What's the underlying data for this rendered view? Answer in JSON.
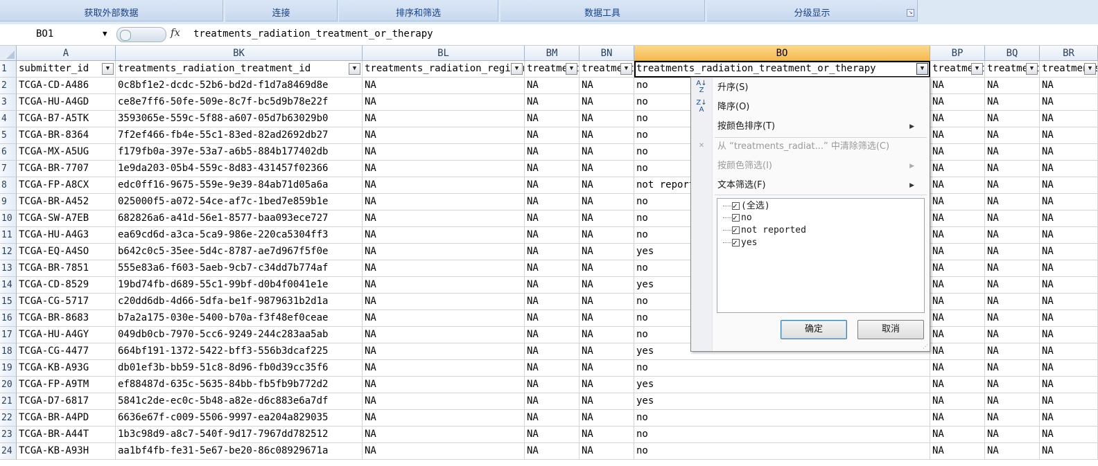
{
  "ribbon": {
    "groups": [
      "获取外部数据",
      "连接",
      "排序和筛选",
      "数据工具",
      "分级显示"
    ]
  },
  "formula_bar": {
    "name_box": "BO1",
    "fx": "fx",
    "formula": "treatments_radiation_treatment_or_therapy"
  },
  "columns": [
    "A",
    "BK",
    "BL",
    "BM",
    "BN",
    "BO",
    "BP",
    "BQ",
    "BR"
  ],
  "header_row": {
    "row_num": "1",
    "cells": [
      "submitter_id",
      "treatments_radiation_treatment_id",
      "treatments_radiation_regimen_or_line_of_therapy",
      "treatments_radiation_therapeutic_agents",
      "treatments_radiation_therapeutic_level",
      "treatments_radiation_treatment_or_therapy",
      "treatments_radiation_treatment_outcome",
      "treatments_radiation_treatment_type",
      "treatments_radiation_updated"
    ]
  },
  "rows": [
    {
      "n": "2",
      "a": "TCGA-CD-A486",
      "bk": "0c8bf1e2-dcdc-52b6-bd2d-f1d7a8469d8e",
      "bo": "no"
    },
    {
      "n": "3",
      "a": "TCGA-HU-A4GD",
      "bk": "ce8e7ff6-50fe-509e-8c7f-bc5d9b78e22f",
      "bo": "no"
    },
    {
      "n": "4",
      "a": "TCGA-B7-A5TK",
      "bk": "3593065e-559c-5f88-a607-05d7b63029b0",
      "bo": "no"
    },
    {
      "n": "5",
      "a": "TCGA-BR-8364",
      "bk": "7f2ef466-fb4e-55c1-83ed-82ad2692db27",
      "bo": "no"
    },
    {
      "n": "6",
      "a": "TCGA-MX-A5UG",
      "bk": "f179fb0a-397e-53a7-a6b5-884b177402db",
      "bo": "no"
    },
    {
      "n": "7",
      "a": "TCGA-BR-7707",
      "bk": "1e9da203-05b4-559c-8d83-431457f02366",
      "bo": "no"
    },
    {
      "n": "8",
      "a": "TCGA-FP-A8CX",
      "bk": "edc0ff16-9675-559e-9e39-84ab71d05a6a",
      "bo": "not reported"
    },
    {
      "n": "9",
      "a": "TCGA-BR-A452",
      "bk": "025000f5-a072-54ce-af7c-1bed7e859b1e",
      "bo": "no"
    },
    {
      "n": "10",
      "a": "TCGA-SW-A7EB",
      "bk": "682826a6-a41d-56e1-8577-baa093ece727",
      "bo": "no"
    },
    {
      "n": "11",
      "a": "TCGA-HU-A4G3",
      "bk": "ea69cd6d-a3ca-5ca9-986e-220ca5304ff3",
      "bo": "no"
    },
    {
      "n": "12",
      "a": "TCGA-EQ-A4SO",
      "bk": "b642c0c5-35ee-5d4c-8787-ae7d967f5f0e",
      "bo": "yes"
    },
    {
      "n": "13",
      "a": "TCGA-BR-7851",
      "bk": "555e83a6-f603-5aeb-9cb7-c34dd7b774af",
      "bo": "no"
    },
    {
      "n": "14",
      "a": "TCGA-CD-8529",
      "bk": "19bd74fb-d689-55c1-99bf-d0b4f0041e1e",
      "bo": "yes"
    },
    {
      "n": "15",
      "a": "TCGA-CG-5717",
      "bk": "c20dd6db-4d66-5dfa-be1f-9879631b2d1a",
      "bo": "no"
    },
    {
      "n": "16",
      "a": "TCGA-BR-8683",
      "bk": "b7a2a175-030e-5400-b70a-f3f48ef0ceae",
      "bo": "no"
    },
    {
      "n": "17",
      "a": "TCGA-HU-A4GY",
      "bk": "049db0cb-7970-5cc6-9249-244c283aa5ab",
      "bo": "no"
    },
    {
      "n": "18",
      "a": "TCGA-CG-4477",
      "bk": "664bf191-1372-5422-bff3-556b3dcaf225",
      "bo": "yes"
    },
    {
      "n": "19",
      "a": "TCGA-KB-A93G",
      "bk": "db01ef3b-bb59-51c8-8d96-fb0d39cc35f6",
      "bo": "no"
    },
    {
      "n": "20",
      "a": "TCGA-FP-A9TM",
      "bk": "ef88487d-635c-5635-84bb-fb5fb9b772d2",
      "bo": "yes"
    },
    {
      "n": "21",
      "a": "TCGA-D7-6817",
      "bk": "5841c2de-ec0c-5b48-a82e-d6c883e6a7df",
      "bo": "yes"
    },
    {
      "n": "22",
      "a": "TCGA-BR-A4PD",
      "bk": "6636e67f-c009-5506-9997-ea204a829035",
      "bo": "no"
    },
    {
      "n": "23",
      "a": "TCGA-BR-A44T",
      "bk": "1b3c98d9-a8c7-540f-9d17-7967dd782512",
      "bo": "no"
    },
    {
      "n": "24",
      "a": "TCGA-KB-A93H",
      "bk": "aa1bf4fb-fe31-5e67-be20-86c08929671a",
      "bo": "no"
    }
  ],
  "na_value": "NA",
  "filter_menu": {
    "sort_asc": "升序(S)",
    "sort_desc": "降序(O)",
    "sort_by_color": "按颜色排序(T)",
    "clear_filter": "从 “treatments_radiat...” 中清除筛选(C)",
    "filter_by_color": "按颜色筛选(I)",
    "text_filter": "文本筛选(F)",
    "options": [
      "(全选)",
      "no",
      "not reported",
      "yes"
    ],
    "ok": "确定",
    "cancel": "取消"
  }
}
